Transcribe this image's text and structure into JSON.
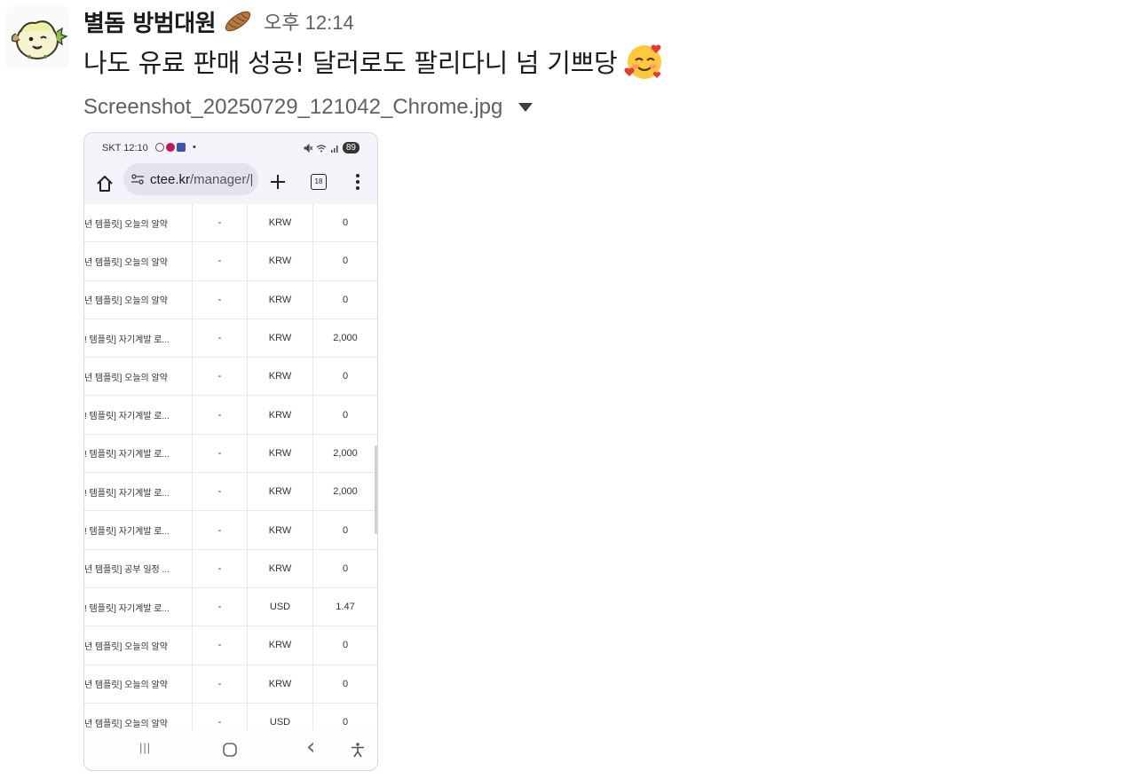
{
  "message": {
    "sender": "별돔 방범대원",
    "status_emoji": "bread-emoji",
    "time": "오후 12:14",
    "text": "나도 유료 판매 성공! 달러로도 팔리다니 넘 기쁘당",
    "text_emoji": "smiling-face-with-hearts-emoji"
  },
  "attachment": {
    "file_name": "Screenshot_20250729_121042_Chrome.jpg",
    "screenshot": {
      "status_bar": {
        "carrier_time": "SKT 12:10",
        "dot": "•",
        "battery": "89"
      },
      "url_bar": {
        "host": "ctee.kr",
        "path": "/manager/|",
        "tab_count": "18"
      },
      "rows": [
        {
          "name": "년 템플릿] 오늘의 알약",
          "dash": "-",
          "currency": "KRW",
          "amount": "0"
        },
        {
          "name": "년 템플릿] 오늘의 알약",
          "dash": "-",
          "currency": "KRW",
          "amount": "0"
        },
        {
          "name": "년 템플릿] 오늘의 알약",
          "dash": "-",
          "currency": "KRW",
          "amount": "0"
        },
        {
          "name": "! 템플릿] 자기계발 로...",
          "dash": "-",
          "currency": "KRW",
          "amount": "2,000"
        },
        {
          "name": "년 템플릿] 오늘의 알약",
          "dash": "-",
          "currency": "KRW",
          "amount": "0"
        },
        {
          "name": "! 템플릿] 자기계발 로...",
          "dash": "-",
          "currency": "KRW",
          "amount": "0"
        },
        {
          "name": "! 템플릿] 자기계발 로...",
          "dash": "-",
          "currency": "KRW",
          "amount": "2,000"
        },
        {
          "name": "! 템플릿] 자기계발 로...",
          "dash": "-",
          "currency": "KRW",
          "amount": "2,000"
        },
        {
          "name": "! 템플릿] 자기계발 로...",
          "dash": "-",
          "currency": "KRW",
          "amount": "0"
        },
        {
          "name": "년 템플릿] 공부 일정 ...",
          "dash": "-",
          "currency": "KRW",
          "amount": "0"
        },
        {
          "name": "! 템플릿] 자기계발 로...",
          "dash": "-",
          "currency": "USD",
          "amount": "1.47"
        },
        {
          "name": "년 템플릿] 오늘의 알약",
          "dash": "-",
          "currency": "KRW",
          "amount": "0"
        },
        {
          "name": "년 템플릿] 오늘의 알약",
          "dash": "-",
          "currency": "KRW",
          "amount": "0"
        },
        {
          "name": "년 템플릿] 오늘의 알약",
          "dash": "-",
          "currency": "USD",
          "amount": "0"
        }
      ],
      "nav_bar": {
        "recents": "|||",
        "back": "‹"
      }
    }
  },
  "colors": {
    "sender_text": "#1d1c1d",
    "meta_text": "#616061",
    "phone_chrome_bg": "#f4f3fa"
  }
}
